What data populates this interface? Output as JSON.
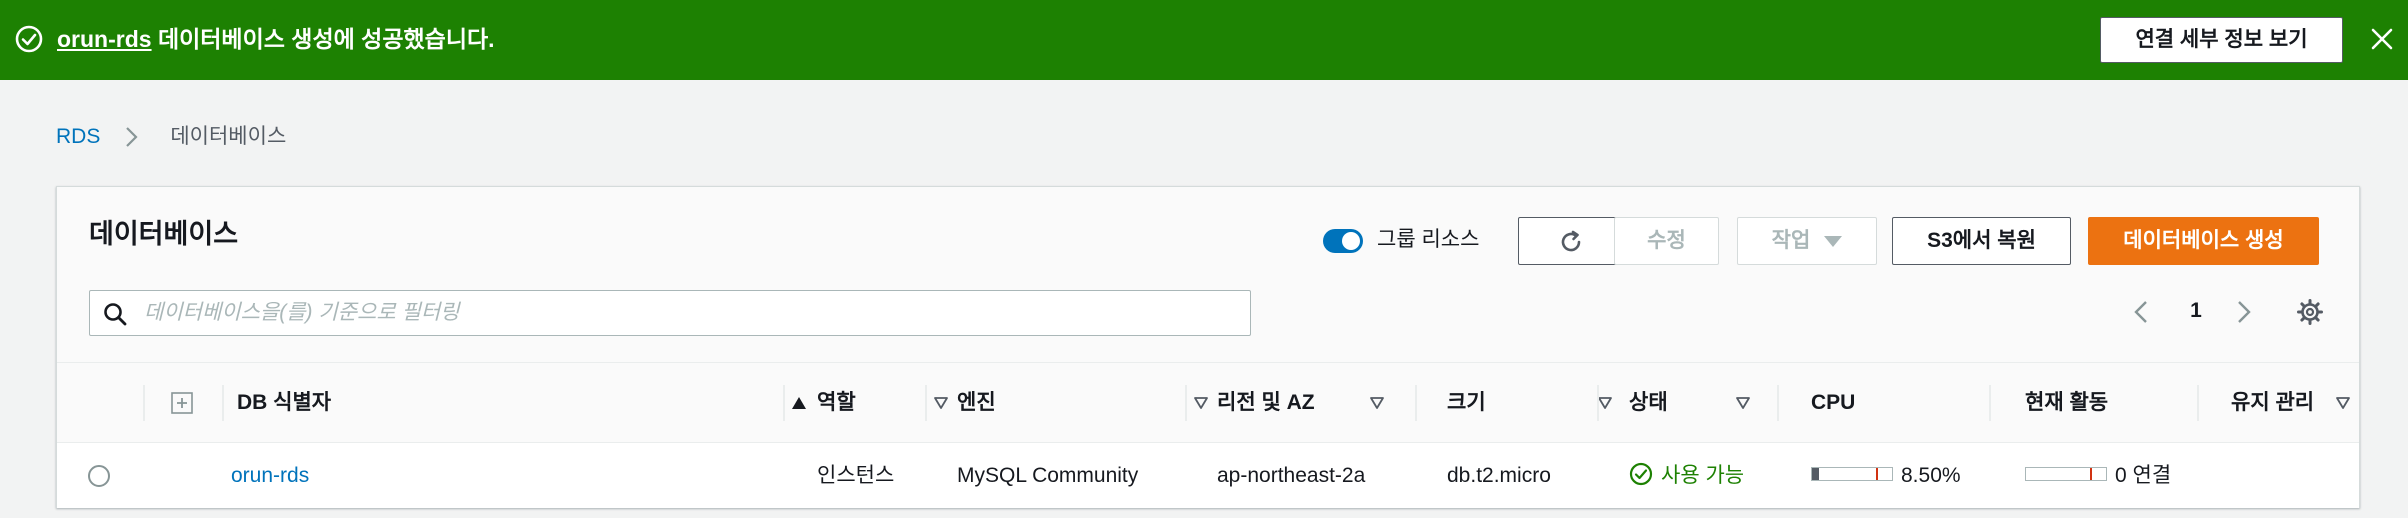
{
  "banner": {
    "db_link": "orun-rds",
    "message": " 데이터베이스 생성에 성공했습니다.",
    "details_button": "연결 세부 정보 보기",
    "icons": {
      "success": "check-circle-icon",
      "close": "close-icon"
    }
  },
  "breadcrumb": {
    "root": "RDS",
    "current": "데이터베이스"
  },
  "panel": {
    "title": "데이터베이스",
    "group_toggle": {
      "label": "그룹 리소스",
      "on": true
    },
    "buttons": {
      "modify": "수정",
      "actions": "작업",
      "restore_s3": "S3에서 복원",
      "create": "데이터베이스 생성"
    },
    "search": {
      "placeholder": "데이터베이스을(를) 기준으로 필터링",
      "value": ""
    },
    "pagination": {
      "current_page": "1"
    }
  },
  "table": {
    "columns": [
      {
        "key": "id",
        "label": "DB 식별자",
        "sort": "ascending"
      },
      {
        "key": "role",
        "label": "역할"
      },
      {
        "key": "engine",
        "label": "엔진"
      },
      {
        "key": "region",
        "label": "리전 및 AZ"
      },
      {
        "key": "size",
        "label": "크기"
      },
      {
        "key": "status",
        "label": "상태"
      },
      {
        "key": "cpu",
        "label": "CPU"
      },
      {
        "key": "activity",
        "label": "현재 활동"
      },
      {
        "key": "maintenance",
        "label": "유지 관리"
      }
    ],
    "rows": [
      {
        "id": "orun-rds",
        "role": "인스턴스",
        "engine": "MySQL Community",
        "region": "ap-northeast-2a",
        "size": "db.t2.micro",
        "status": "사용 가능",
        "cpu": "8.50%",
        "cpu_fraction": 0.085,
        "activity": "0 연결",
        "activity_fraction": 0
      }
    ]
  },
  "colors": {
    "success_green": "#1d8102",
    "primary_orange": "#ec7211",
    "link_blue": "#0073bb",
    "meter_marker": "#d13212"
  }
}
